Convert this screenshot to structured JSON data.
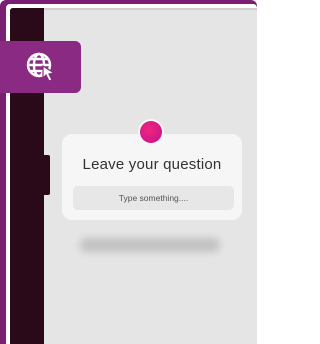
{
  "question_card": {
    "title": "Leave your question",
    "input_placeholder": "Type something...."
  },
  "badge": {
    "icon": "globe-cursor-icon"
  },
  "colors": {
    "frame": "#7a1f73",
    "badge": "#8b2a82",
    "accent_dot": "#e0187f",
    "screen_bg": "#e5e5e5",
    "card_bg": "#f6f6f6"
  }
}
